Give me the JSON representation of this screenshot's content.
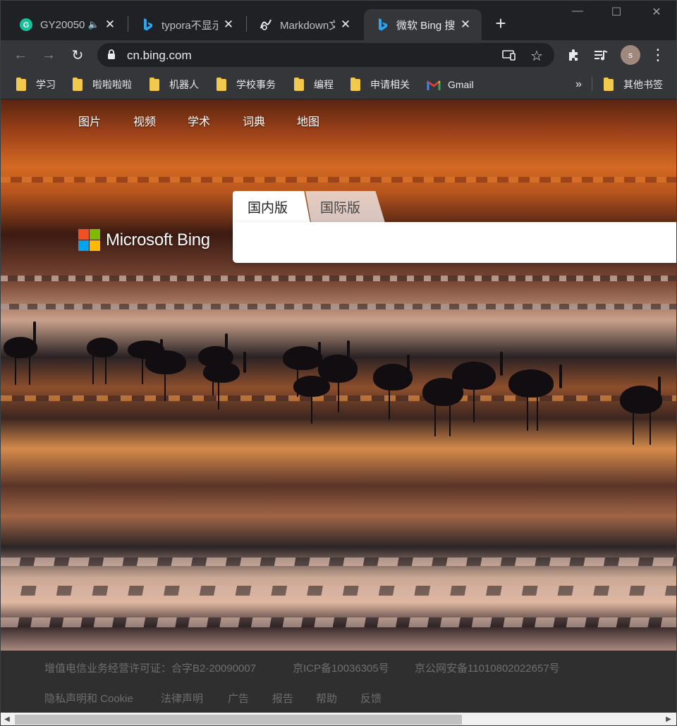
{
  "tabs": [
    {
      "title": "GY20050",
      "icon": "grammarly-icon",
      "audio": true
    },
    {
      "title": "typora不显示",
      "icon": "bing-icon"
    },
    {
      "title": "Markdown文",
      "icon": "markdown-icon"
    },
    {
      "title": "微软 Bing 搜",
      "icon": "bing-icon",
      "active": true
    }
  ],
  "tab_close": "✕",
  "new_tab": "+",
  "window_controls": {
    "minimize": "—",
    "maximize": "☐",
    "close": "✕"
  },
  "toolbar": {
    "back": "←",
    "forward": "→",
    "reload": "↻",
    "url": "cn.bing.com",
    "avatar_initial": "s",
    "menu": "⋮"
  },
  "bookmarks": [
    {
      "label": "学习",
      "type": "folder"
    },
    {
      "label": "啦啦啦啦",
      "type": "folder"
    },
    {
      "label": "机器人",
      "type": "folder"
    },
    {
      "label": "学校事务",
      "type": "folder"
    },
    {
      "label": "编程",
      "type": "folder"
    },
    {
      "label": "申请相关",
      "type": "folder"
    },
    {
      "label": "Gmail",
      "type": "gmail"
    }
  ],
  "bookmarks_overflow": "»",
  "other_bookmarks": "其他书签",
  "bing": {
    "nav": [
      "图片",
      "视频",
      "学术",
      "词典",
      "地图"
    ],
    "logo_text": "Microsoft Bing",
    "search_tabs": [
      "国内版",
      "国际版"
    ],
    "search_placeholder": "",
    "brand_colors": [
      "#f25022",
      "#7fba00",
      "#00a4ef",
      "#ffb900"
    ]
  },
  "footer": {
    "row1": [
      "增值电信业务经营许可证：合字B2-20090007",
      "京ICP备10036305号",
      "京公网安备11010802022657号"
    ],
    "row2": [
      "隐私声明和 Cookie",
      "法律声明",
      "广告",
      "报告",
      "帮助",
      "反馈"
    ]
  },
  "scrollbar": {
    "left_arrow": "◀",
    "right_arrow": "▶"
  }
}
